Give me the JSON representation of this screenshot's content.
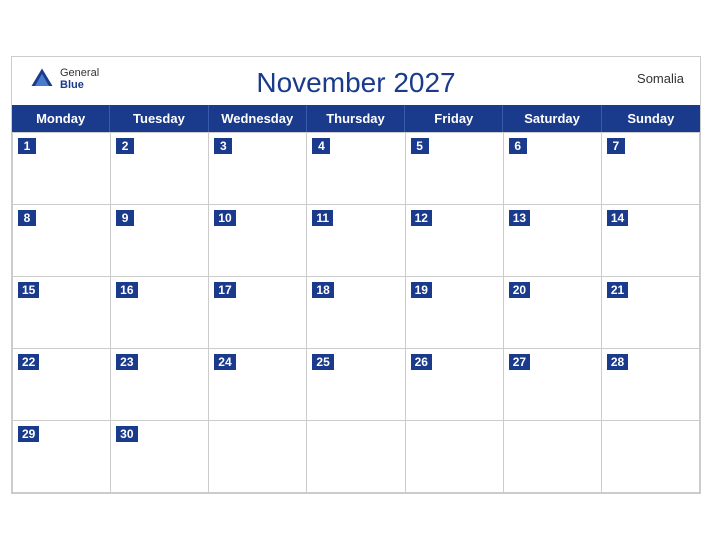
{
  "header": {
    "month_year": "November 2027",
    "country": "Somalia",
    "logo_general": "General",
    "logo_blue": "Blue"
  },
  "days_of_week": [
    "Monday",
    "Tuesday",
    "Wednesday",
    "Thursday",
    "Friday",
    "Saturday",
    "Sunday"
  ],
  "weeks": [
    [
      {
        "date": 1,
        "empty": false
      },
      {
        "date": 2,
        "empty": false
      },
      {
        "date": 3,
        "empty": false
      },
      {
        "date": 4,
        "empty": false
      },
      {
        "date": 5,
        "empty": false
      },
      {
        "date": 6,
        "empty": false
      },
      {
        "date": 7,
        "empty": false
      }
    ],
    [
      {
        "date": 8,
        "empty": false
      },
      {
        "date": 9,
        "empty": false
      },
      {
        "date": 10,
        "empty": false
      },
      {
        "date": 11,
        "empty": false
      },
      {
        "date": 12,
        "empty": false
      },
      {
        "date": 13,
        "empty": false
      },
      {
        "date": 14,
        "empty": false
      }
    ],
    [
      {
        "date": 15,
        "empty": false
      },
      {
        "date": 16,
        "empty": false
      },
      {
        "date": 17,
        "empty": false
      },
      {
        "date": 18,
        "empty": false
      },
      {
        "date": 19,
        "empty": false
      },
      {
        "date": 20,
        "empty": false
      },
      {
        "date": 21,
        "empty": false
      }
    ],
    [
      {
        "date": 22,
        "empty": false
      },
      {
        "date": 23,
        "empty": false
      },
      {
        "date": 24,
        "empty": false
      },
      {
        "date": 25,
        "empty": false
      },
      {
        "date": 26,
        "empty": false
      },
      {
        "date": 27,
        "empty": false
      },
      {
        "date": 28,
        "empty": false
      }
    ],
    [
      {
        "date": 29,
        "empty": false
      },
      {
        "date": 30,
        "empty": false
      },
      {
        "date": null,
        "empty": true
      },
      {
        "date": null,
        "empty": true
      },
      {
        "date": null,
        "empty": true
      },
      {
        "date": null,
        "empty": true
      },
      {
        "date": null,
        "empty": true
      }
    ]
  ]
}
